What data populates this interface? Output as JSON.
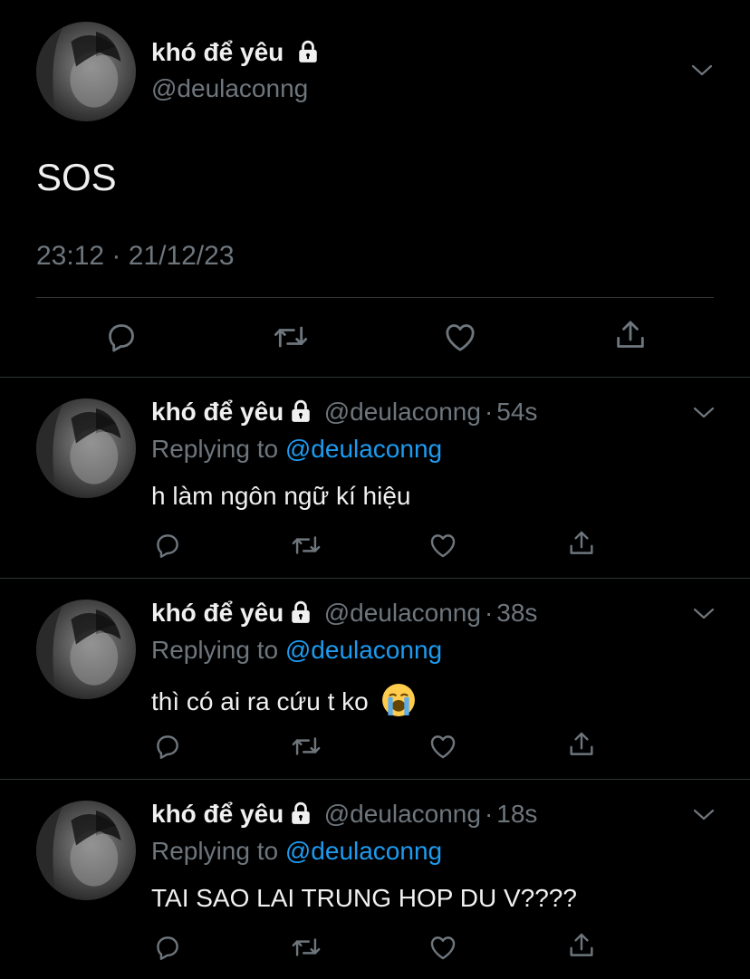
{
  "main_tweet": {
    "name": "khó để yêu",
    "handle": "@deulaconng",
    "text": "SOS",
    "timestamp": "23:12 · 21/12/23"
  },
  "replies": [
    {
      "name": "khó để yêu",
      "handle": "@deulaconng",
      "dot": "·",
      "time": "54s",
      "replying_prefix": "Replying to",
      "replying_to": "@deulaconng",
      "text": "h làm ngôn ngữ kí hiệu"
    },
    {
      "name": "khó để yêu",
      "handle": "@deulaconng",
      "dot": "·",
      "time": "38s",
      "replying_prefix": "Replying to",
      "replying_to": "@deulaconng",
      "text": "thì có ai ra cứu t ko",
      "emoji": "loudly-crying-face"
    },
    {
      "name": "khó để yêu",
      "handle": "@deulaconng",
      "dot": "·",
      "time": "18s",
      "replying_prefix": "Replying to",
      "replying_to": "@deulaconng",
      "text": "TAI SAO LAI TRUNG HOP DU V????"
    }
  ],
  "icons": [
    "lock-icon",
    "chevron-down-icon",
    "reply-icon",
    "retweet-icon",
    "like-icon",
    "share-icon"
  ],
  "colors": {
    "background": "#000000",
    "text": "#e7e9ea",
    "secondary": "#6e767d",
    "link": "#1d9bf0",
    "divider": "#2f3336"
  }
}
